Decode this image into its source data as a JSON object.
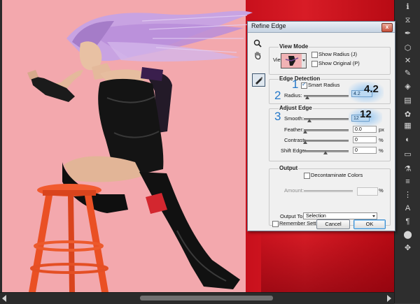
{
  "dialog": {
    "title": "Refine Edge",
    "close_label": "x"
  },
  "view_mode": {
    "title": "View Mode",
    "view_label": "View:",
    "show_radius": "Show Radius (J)",
    "show_original": "Show Original (P)"
  },
  "edge_detection": {
    "title": "Edge Detection",
    "smart_radius": "Smart Radius",
    "smart_radius_checked": true,
    "radius_label": "Radius:",
    "radius_value": "4.2",
    "radius_fraction": 0.08
  },
  "adjust_edge": {
    "title": "Adjust Edge",
    "smooth_label": "Smooth:",
    "smooth_value": "12",
    "smooth_fraction": 0.12,
    "feather_label": "Feather:",
    "feather_value": "0.0",
    "feather_unit": "px",
    "contrast_label": "Contrast:",
    "contrast_value": "0",
    "contrast_unit": "%",
    "shift_edge_label": "Shift Edge:",
    "shift_edge_value": "0",
    "shift_edge_unit": "%"
  },
  "output": {
    "title": "Output",
    "decontaminate": "Decontaminate Colors",
    "amount_label": "Amount:",
    "amount_unit": "%",
    "output_to_label": "Output To:",
    "output_to_value": "Selection"
  },
  "remember_settings": "Remember Settings",
  "buttons": {
    "cancel": "Cancel",
    "ok": "OK"
  },
  "callouts": {
    "step1": "1",
    "step2": "2",
    "step3": "3",
    "radius_big": "4.2",
    "smooth_big": "12"
  },
  "colors": {
    "canvas_pink": "#f3a8ad",
    "canvas_red": "#c8101c",
    "callout_blue": "#2578c9",
    "app_panel": "#2e2e2e"
  },
  "tools": [
    "info-icon",
    "history-icon",
    "pen-icon",
    "three-d-icon",
    "transform-icon",
    "brush-icon",
    "layers-icon",
    "color-icon",
    "swatches-icon",
    "adjust-icon",
    "masks-icon",
    "channels-icon",
    "paths-icon",
    "timeline-icon",
    "brush-preset-icon",
    "character-icon",
    "paragraph-icon",
    "clone-icon",
    "tool-presets-icon"
  ]
}
